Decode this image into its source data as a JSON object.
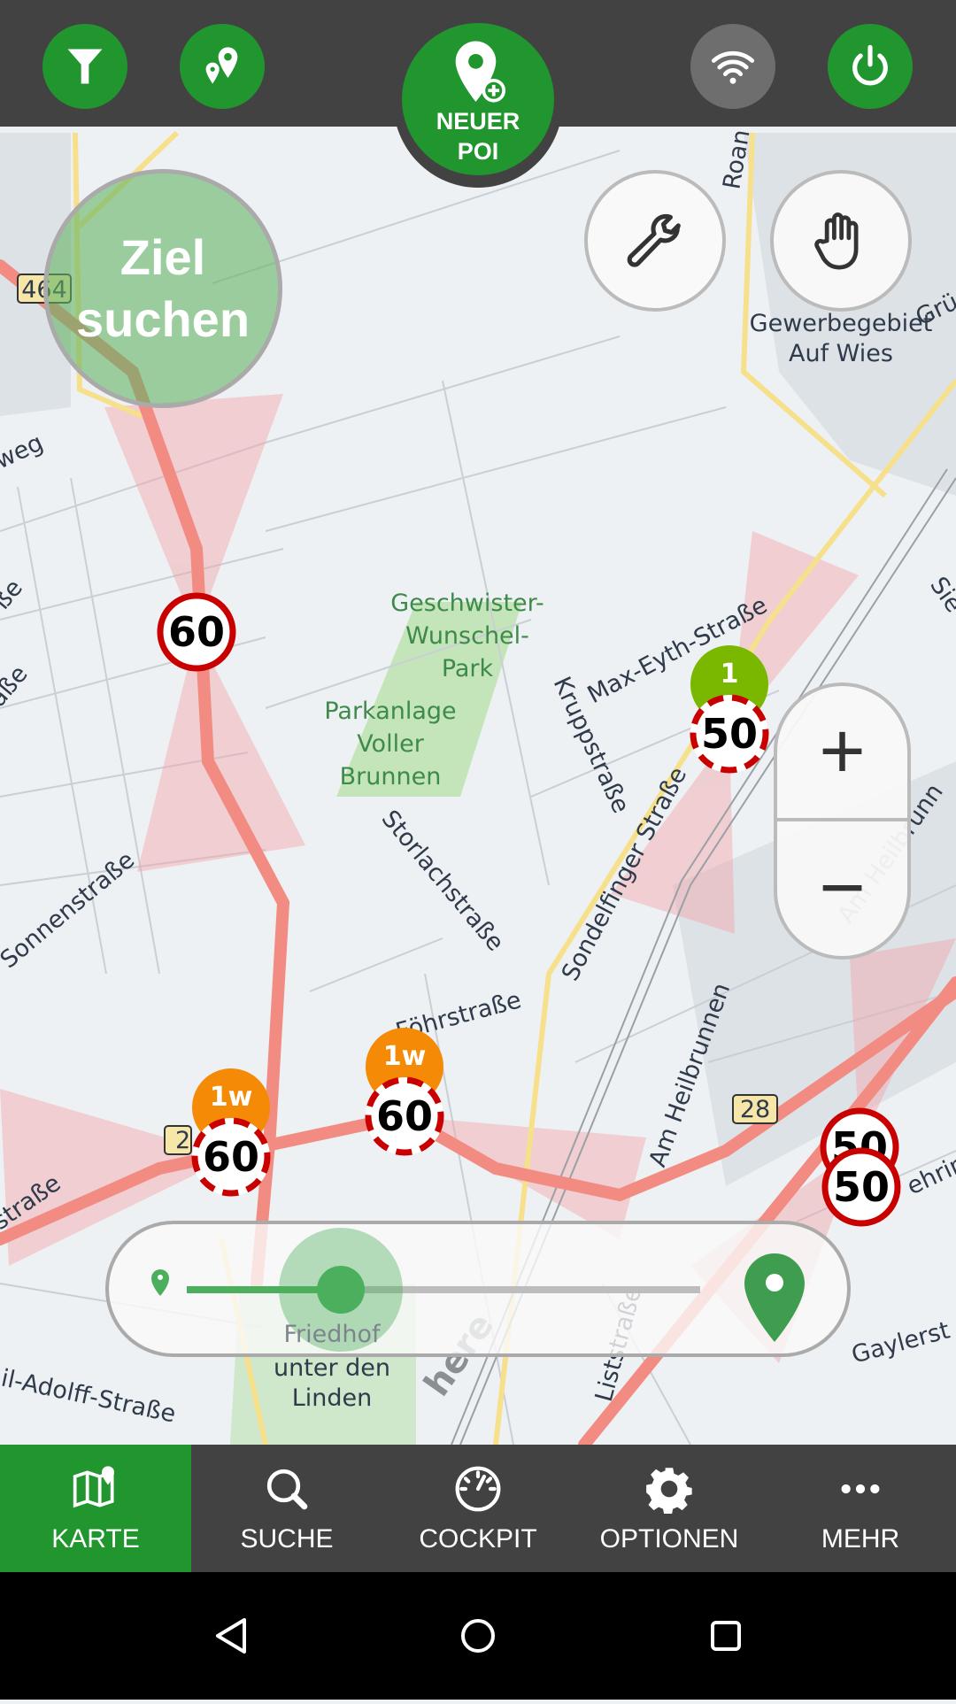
{
  "colors": {
    "accent": "#21962f",
    "topbar": "#424242",
    "speed_ring": "#c80000",
    "badge_orange": "#f58a07",
    "badge_green": "#7ab800"
  },
  "topbar": {
    "filter_icon": "filter-icon",
    "poi_icon": "map-pins-icon",
    "new_poi": {
      "line1": "NEUER",
      "line2": "POI",
      "icon": "map-pin-plus-icon"
    },
    "wifi_icon": "wifi-icon",
    "power_icon": "power-icon"
  },
  "map": {
    "search_destination": {
      "line1": "Ziel",
      "line2": "suchen"
    },
    "tools_icon": "wrench-icon",
    "pan_icon": "hand-icon",
    "zoom_in": "+",
    "zoom_out": "−",
    "labels": {
      "weg": "weg",
      "road464": "464",
      "road28": "28",
      "road2": "2",
      "roan": "Roan",
      "gruen": "Grü",
      "gewerbe1": "Gewerbegebiet",
      "gewerbe2": "Auf Wies",
      "park1a": "Geschwister-",
      "park1b": "Wunschel-",
      "park1c": "Park",
      "park2a": "Parkanlage",
      "park2b": "Voller",
      "park2c": "Brunnen",
      "maxeyth": "Max-Eyth-Straße",
      "krupp": "Kruppstraße",
      "storlach": "Storlachstraße",
      "sondelfinger": "Sondelfinger Straße",
      "sonnen": "Sonnenstraße",
      "foehr": "Föhrstraße",
      "amheil1": "Am Heilbrunnen",
      "amheil2": "Am Heilbrunn",
      "liststr": "Liststraße",
      "gaylerst": "Gaylerst",
      "fehrin": "ehrin",
      "strasse_left": "straße",
      "adolff": "il-Adolff-Straße",
      "friedhof1": "Friedhof",
      "friedhof2": "unter den",
      "friedhof3": "Linden",
      "sse1": "ße",
      "sse2": "aße",
      "sie": "Sie",
      "here": "here"
    },
    "speed_signs": [
      {
        "limit": "60",
        "badge": ""
      },
      {
        "limit": "50",
        "badge": "1"
      },
      {
        "limit": "60",
        "badge": "1w"
      },
      {
        "limit": "60",
        "badge": "1w"
      },
      {
        "limit": "50",
        "badge": ""
      },
      {
        "limit": "50",
        "badge": ""
      }
    ],
    "range_slider": {
      "value_fraction": 0.3,
      "min_icon": "small-pin-icon",
      "max_icon": "large-pin-icon"
    }
  },
  "bottom_nav": [
    {
      "label": "KARTE",
      "icon": "map-icon",
      "active": true
    },
    {
      "label": "SUCHE",
      "icon": "search-icon",
      "active": false
    },
    {
      "label": "COCKPIT",
      "icon": "speedometer-icon",
      "active": false
    },
    {
      "label": "OPTIONEN",
      "icon": "gear-icon",
      "active": false
    },
    {
      "label": "MEHR",
      "icon": "more-icon",
      "active": false
    }
  ],
  "system_nav": {
    "back": "back-icon",
    "home": "home-icon",
    "recents": "recents-icon"
  }
}
